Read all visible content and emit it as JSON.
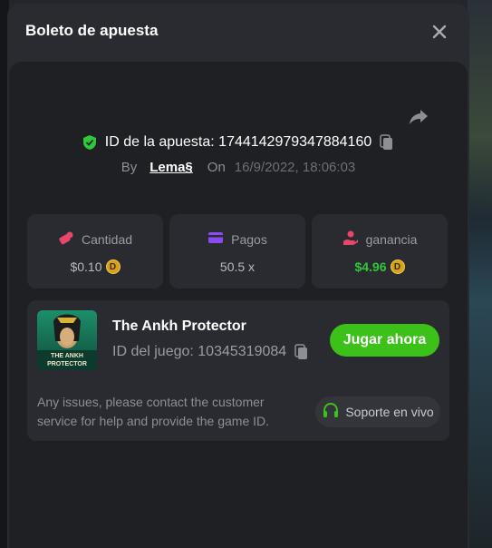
{
  "modal": {
    "title": "Boleto de apuesta"
  },
  "bet": {
    "id_label": "ID de la apuesta: 1744142979347884160",
    "by_label": "By",
    "username": "Lema§",
    "on_label": "On",
    "date": "16/9/2022, 18:06:03"
  },
  "stats": [
    {
      "label": "Cantidad",
      "value": "$0.10",
      "icon": "bet-chips-icon"
    },
    {
      "label": "Pagos",
      "value": "50.5 x",
      "icon": "card-icon"
    },
    {
      "label": "ganancia",
      "value": "$4.96",
      "icon": "profit-hand-icon"
    }
  ],
  "game": {
    "title": "The Ankh Protector",
    "thumb_text_1": "THE ANKH",
    "thumb_text_2": "PROTECTOR",
    "id_label": "ID del juego: 10345319084",
    "play_label": "Jugar ahora",
    "issue_text": "Any issues, please contact the customer service for help and provide the game ID.",
    "support_label": "Soporte en vivo"
  },
  "coin_symbol": "D",
  "colors": {
    "accent_green": "#3bc117",
    "profit_green": "#2ec93a",
    "shield_green": "#2ec93a"
  }
}
